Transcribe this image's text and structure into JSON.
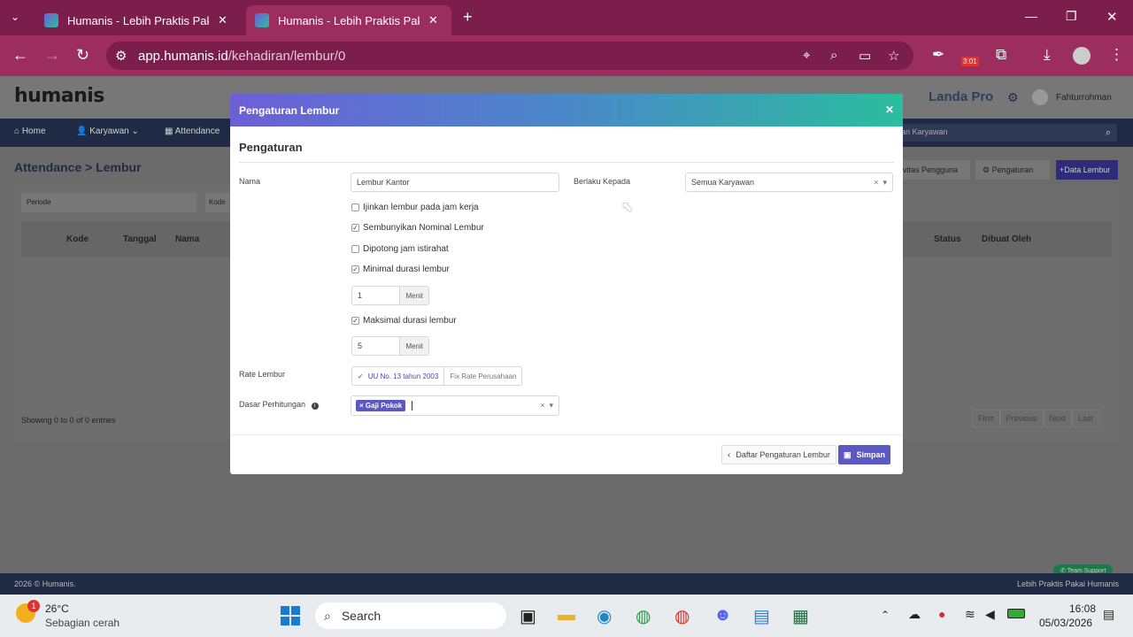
{
  "browser": {
    "tabs": [
      {
        "title": "Humanis - Lebih Praktis Pakai H",
        "active": false
      },
      {
        "title": "Humanis - Lebih Praktis Pakai H",
        "active": true
      }
    ],
    "url_host": "app.humanis.id",
    "url_path": "/kehadiran/lembur/0",
    "badge_time": "3:01"
  },
  "app": {
    "logo": "humanis",
    "company": "Landa Pro",
    "user": "Fahturrohman",
    "nav": [
      "Home",
      "Karyawan",
      "Attendance"
    ],
    "search_placeholder": "ari Karyawan",
    "breadcrumb_root": "Attendance",
    "breadcrumb_leaf": "Lembur",
    "periode_placeholder": "Periode",
    "kode_placeholder": "Kode",
    "btn_aktivitas": "ivitas Pengguna",
    "btn_pengaturan": "Pengaturan",
    "btn_data_lembur": "+Data Lembur",
    "table_headers": [
      "Kode",
      "Tanggal",
      "Nama",
      "Status",
      "Dibuat Oleh"
    ],
    "showing": "Showing 0 to 0 of 0 entries",
    "pagination": [
      "First",
      "Previous",
      "Next",
      "Last"
    ],
    "footer_left": "2026 © Humanis.",
    "footer_right": "Lebih Praktis Pakai Humanis",
    "team_support": "Team Support"
  },
  "modal": {
    "title": "Pengaturan Lembur",
    "section": "Pengaturan",
    "nama_label": "Nama",
    "nama_value": "Lembur Kantor",
    "berlaku_label": "Berlaku Kepada",
    "berlaku_value": "Semua Karyawan",
    "checks": [
      {
        "label": "Ijinkan lembur pada jam kerja",
        "checked": false
      },
      {
        "label": "Sembunyikan Nominal Lembur",
        "checked": true
      },
      {
        "label": "Dipotong jam istirahat",
        "checked": false
      },
      {
        "label": "Minimal durasi lembur",
        "checked": true
      },
      {
        "label": "Maksimal durasi lembur",
        "checked": true
      }
    ],
    "min_value": "1",
    "max_value": "5",
    "unit": "Menit",
    "rate_label": "Rate Lembur",
    "rate_options": [
      "UU No. 13 tahun 2003",
      "Fix Rate Perusahaan"
    ],
    "dasar_label": "Dasar Perhitungan",
    "dasar_tag": "Gaji Pokok",
    "btn_back": "Daftar Pengaturan Lembur",
    "btn_save": "Simpan"
  },
  "taskbar": {
    "weather_temp": "26°C",
    "weather_desc": "Sebagian cerah",
    "weather_badge": "1",
    "search": "Search",
    "time": "16:08",
    "date": "05/03/2026"
  },
  "colors": {
    "accent": "#5b58c4",
    "chrome": "#9b2e5f",
    "nav": "#1f2a44"
  }
}
